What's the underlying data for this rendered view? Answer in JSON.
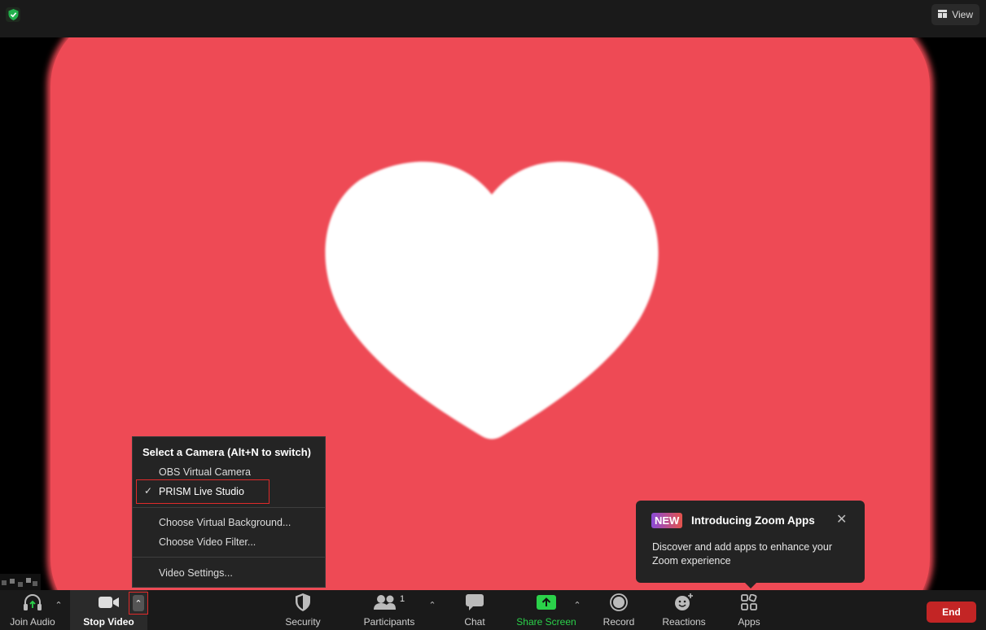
{
  "topbar": {
    "security_icon": "shield-check-icon",
    "view_label": "View"
  },
  "toolbar": {
    "join_audio": "Join Audio",
    "stop_video": "Stop Video",
    "security": "Security",
    "participants": "Participants",
    "participants_count": "1",
    "chat": "Chat",
    "share_screen": "Share Screen",
    "record": "Record",
    "reactions": "Reactions",
    "apps": "Apps",
    "end": "End"
  },
  "camera_menu": {
    "header": "Select a Camera (Alt+N to switch)",
    "cameras": [
      "OBS Virtual Camera",
      "PRISM Live Studio"
    ],
    "selected": "PRISM Live Studio",
    "actions": [
      "Choose Virtual Background...",
      "Choose Video Filter..."
    ],
    "settings": "Video Settings..."
  },
  "apps_popup": {
    "badge": "NEW",
    "title": "Introducing Zoom Apps",
    "body": "Discover and add apps to enhance your Zoom experience"
  },
  "colors": {
    "card": "#ee4a55",
    "end": "#c32525",
    "share_green": "#2bd14a",
    "highlight": "#e02a2a"
  }
}
